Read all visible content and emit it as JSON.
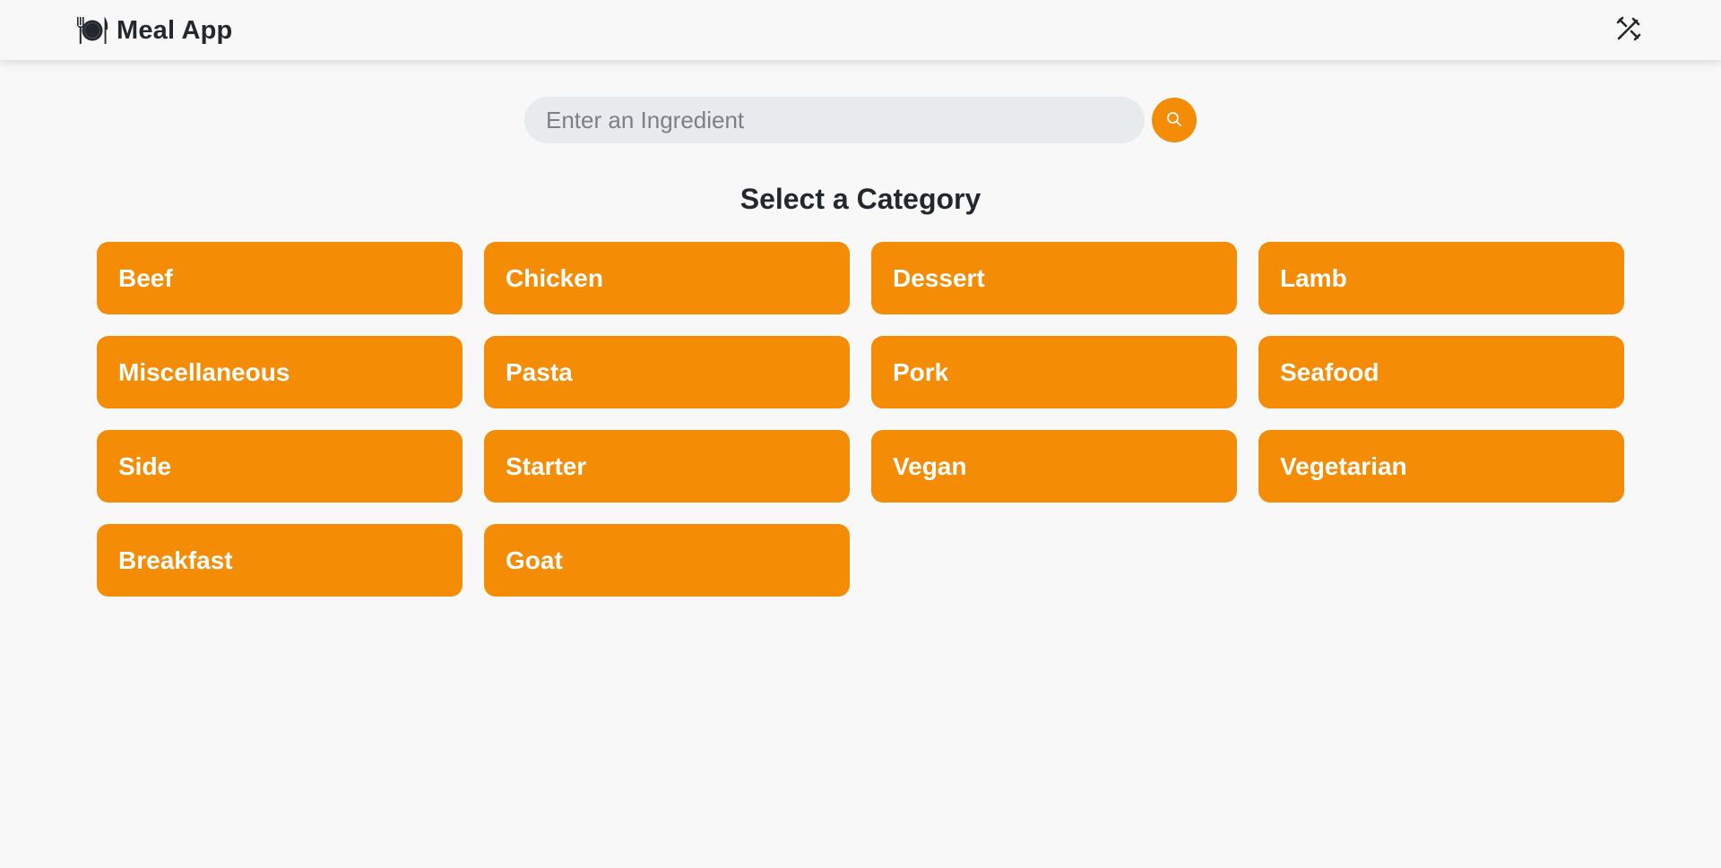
{
  "navbar": {
    "brand_title": "Meal App",
    "brand_icon": "plate-with-utensils-icon",
    "tools_icon": "tools-icon"
  },
  "search": {
    "placeholder": "Enter an Ingredient",
    "value": "",
    "button_icon": "search-icon"
  },
  "main": {
    "title": "Select a Category",
    "categories": [
      {
        "label": "Beef"
      },
      {
        "label": "Chicken"
      },
      {
        "label": "Dessert"
      },
      {
        "label": "Lamb"
      },
      {
        "label": "Miscellaneous"
      },
      {
        "label": "Pasta"
      },
      {
        "label": "Pork"
      },
      {
        "label": "Seafood"
      },
      {
        "label": "Side"
      },
      {
        "label": "Starter"
      },
      {
        "label": "Vegan"
      },
      {
        "label": "Vegetarian"
      },
      {
        "label": "Breakfast"
      },
      {
        "label": "Goat"
      }
    ]
  },
  "colors": {
    "accent": "#f48c06",
    "background": "#f8f8f8",
    "input_background": "#e8ebee",
    "text": "#23272e"
  }
}
